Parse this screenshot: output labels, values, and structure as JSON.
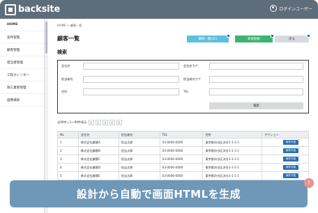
{
  "app": {
    "logo_text": "backsite",
    "user_name": "ログインユーザー"
  },
  "sidebar": {
    "items": [
      {
        "label": "HOME"
      },
      {
        "label": "案件管理"
      },
      {
        "label": "顧客管理"
      },
      {
        "label": "担当者管理"
      },
      {
        "label": "工程カレンダー"
      },
      {
        "label": "施工業者管理"
      },
      {
        "label": "画像検索"
      }
    ]
  },
  "breadcrumb": "HOME > 顧客一覧",
  "page_title": "顧客一覧",
  "buttons": {
    "csv": "顧客一覧CSV",
    "new": "新規登録",
    "back": "戻る"
  },
  "search": {
    "title": "検索",
    "labels": {
      "company": "会社名",
      "company_kana": "会社名カナ",
      "contact": "担当者名",
      "contact_kana": "担当者名カナ",
      "address": "住所",
      "tel": "TEL"
    },
    "button": "検索"
  },
  "pager": {
    "summary": "全99件 | 1〜99件表示",
    "pages": [
      "1",
      "2",
      "3",
      "4",
      "5"
    ]
  },
  "table": {
    "headers": [
      "No",
      "会社名",
      "担当者名",
      "TEL",
      "住所",
      "アクション"
    ],
    "rows": [
      {
        "no": "1",
        "company": "株式会社顧客A",
        "contact": "担当太郎",
        "tel": "03-0000-0000",
        "address": "東京都渋谷区渋谷1-1-1-1",
        "action": "案件作成"
      },
      {
        "no": "2",
        "company": "株式会社顧客B",
        "contact": "担当太郎",
        "tel": "03-0000-0000",
        "address": "東京都渋谷区渋谷1-1-1-1",
        "action": "案件作成"
      },
      {
        "no": "3",
        "company": "株式会社顧客C",
        "contact": "担当太郎",
        "tel": "03-0000-0000",
        "address": "東京都渋谷区渋谷1-1-1-1",
        "action": "案件作成"
      },
      {
        "no": "4",
        "company": "株式会社顧客D",
        "contact": "担当太郎",
        "tel": "03-0000-0000",
        "address": "東京都渋谷区渋谷1-1-1-1",
        "action": "案件作成"
      },
      {
        "no": "5",
        "company": "株式会社顧客E",
        "contact": "担当太郎",
        "tel": "03-0000-0000",
        "address": "東京都渋谷区渋谷1-1-1-1",
        "action": "案件作成"
      }
    ]
  },
  "banner": "設計から自動で画面HTMLを生成",
  "colors": {
    "header": "#5e6d7a",
    "csv": "#5bc0de",
    "new": "#3cb371",
    "accent": "#2a6fb3",
    "banner": "#6f97b7"
  }
}
